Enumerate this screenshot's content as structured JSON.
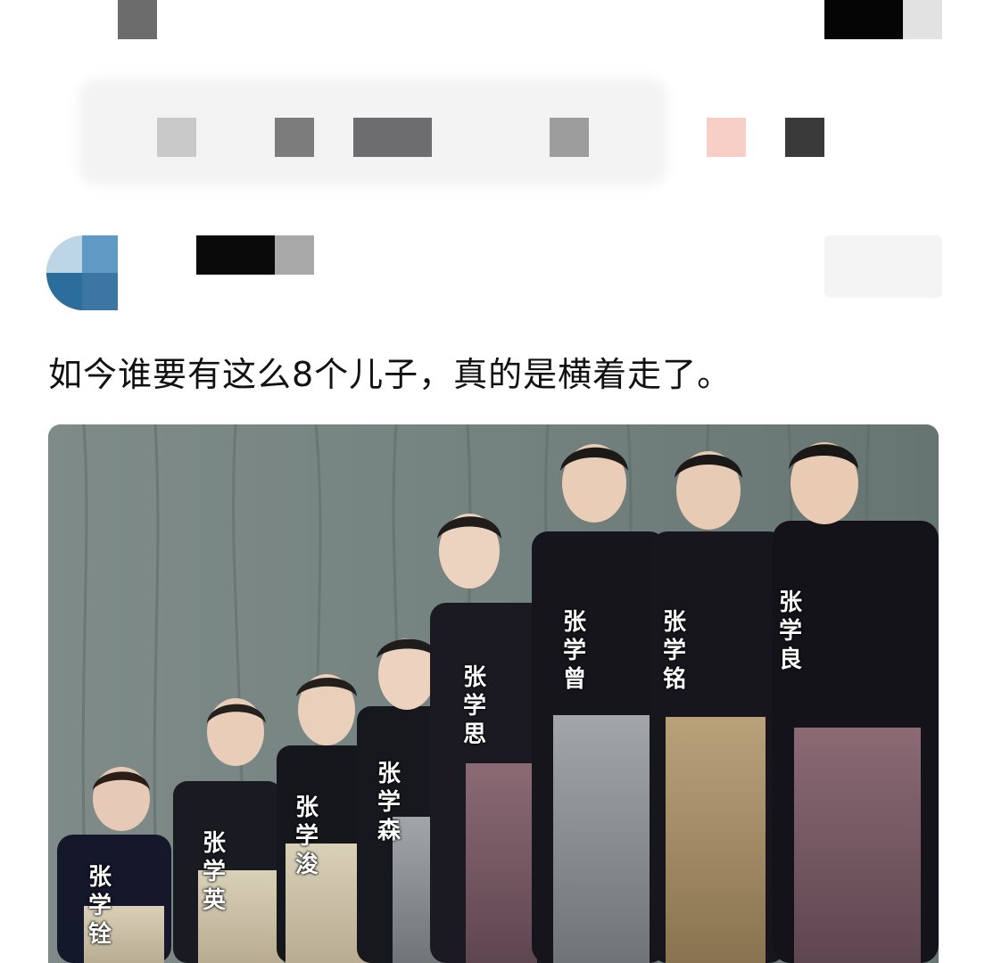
{
  "post": {
    "text": "如今谁要有这么8个儿子，真的是横着走了。"
  },
  "photo": {
    "name_tags": [
      {
        "name": "张学良",
        "chars": [
          "张",
          "学",
          "良"
        ]
      },
      {
        "name": "张学铭",
        "chars": [
          "张",
          "学",
          "铭"
        ]
      },
      {
        "name": "张学曾",
        "chars": [
          "张",
          "学",
          "曾"
        ]
      },
      {
        "name": "张学思",
        "chars": [
          "张",
          "学",
          "思"
        ]
      },
      {
        "name": "张学森",
        "chars": [
          "张",
          "学",
          "森"
        ]
      },
      {
        "name": "张学浚",
        "chars": [
          "张",
          "学",
          "浚"
        ]
      },
      {
        "name": "张学英",
        "chars": [
          "张",
          "学",
          "英"
        ]
      },
      {
        "name": "张学铨",
        "chars": [
          "张",
          "学",
          "铨"
        ]
      }
    ]
  },
  "colors": {
    "background": "#ffffff",
    "text": "#111111",
    "photo_backdrop": "#6f7c79",
    "robe_dark": "#1a1a22"
  }
}
